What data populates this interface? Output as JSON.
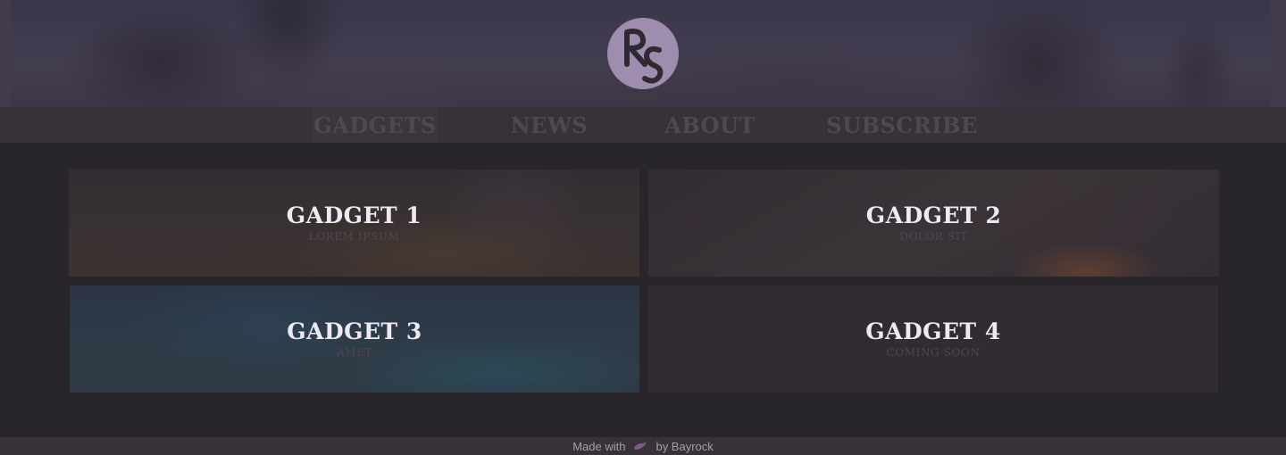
{
  "logo": {
    "monogram": "RS"
  },
  "nav": {
    "items": [
      {
        "label": "GADGETS",
        "active": true
      },
      {
        "label": "NEWS",
        "active": false
      },
      {
        "label": "ABOUT",
        "active": false
      },
      {
        "label": "SUBSCRIBE",
        "active": false
      }
    ]
  },
  "cards": [
    {
      "title": "GADGET 1",
      "subtitle": "LOREM IPSUM"
    },
    {
      "title": "GADGET 2",
      "subtitle": "DOLOR SIT"
    },
    {
      "title": "GADGET 3",
      "subtitle": "AMET"
    },
    {
      "title": "GADGET 4",
      "subtitle": "COMING SOON"
    }
  ],
  "footer": {
    "made_with": "Made with",
    "icon": "heart-icon",
    "by": "by Bayrock"
  },
  "colors": {
    "background": "#29262b",
    "nav_bar": "#373239",
    "logo_circle": "#9f8db0",
    "footer_icon": "#7d5b83"
  }
}
